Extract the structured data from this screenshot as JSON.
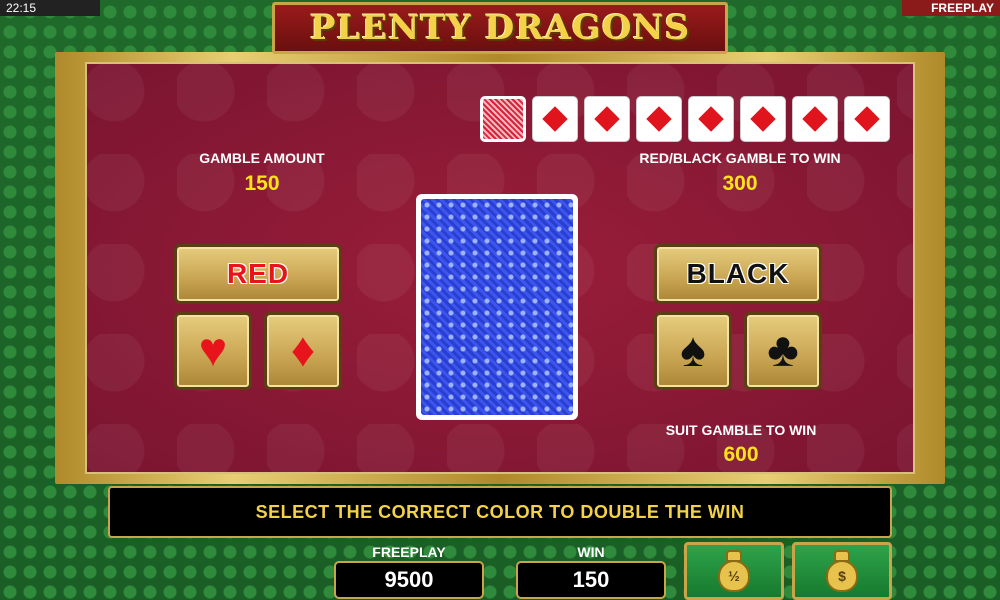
{
  "status": {
    "time": "22:15",
    "mode": "FREEPLAY"
  },
  "title": "PLENTY DRAGONS",
  "history": {
    "cards": [
      "back",
      "diamond",
      "diamond",
      "diamond",
      "diamond",
      "diamond",
      "diamond",
      "diamond"
    ]
  },
  "gamble_amount": {
    "label": "GAMBLE AMOUNT",
    "value": "150"
  },
  "color_win": {
    "label": "RED/BLACK GAMBLE TO WIN",
    "value": "300"
  },
  "suit_win": {
    "label": "SUIT GAMBLE TO WIN",
    "value": "600"
  },
  "buttons": {
    "red": "RED",
    "black": "BLACK",
    "heart": "♥",
    "diamond": "♦",
    "spade": "♠",
    "club": "♣"
  },
  "message": "SELECT THE CORRECT COLOR TO DOUBLE THE WIN",
  "freeplay": {
    "label": "FREEPLAY",
    "value": "9500"
  },
  "win": {
    "label": "WIN",
    "value": "150"
  },
  "collect": {
    "half_label": "½",
    "full_label": "$"
  },
  "colors": {
    "red": "#e8141c",
    "gold": "#c9a54a",
    "yellow": "#ffe21a",
    "green": "#1a5e25",
    "crimson": "#8a1732"
  }
}
